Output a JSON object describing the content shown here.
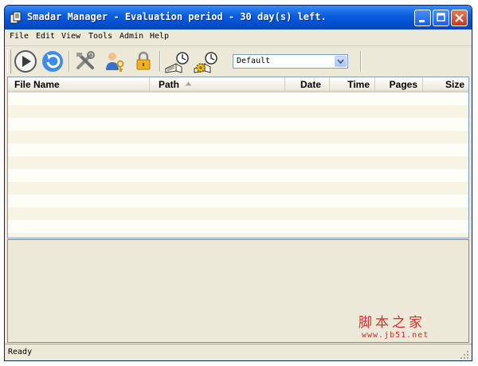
{
  "window": {
    "title": "Smadar Manager - Evaluation period - 30 day(s) left."
  },
  "menu": [
    "File",
    "Edit",
    "View",
    "Tools",
    "Admin",
    "Help"
  ],
  "toolbar": {
    "buttons": [
      "play-icon",
      "refresh-icon",
      "tools-icon",
      "user-key-icon",
      "lock-icon",
      "book-clock-icon",
      "book-clock-gear-icon"
    ],
    "profile_select_value": "Default"
  },
  "file_list": {
    "columns": [
      "File Name",
      "Path",
      "Date",
      "Time",
      "Pages",
      "Size"
    ],
    "sorted_column": "Path",
    "rows": []
  },
  "watermark": {
    "text": "脚本之家",
    "url": "www.jb51.net"
  },
  "status": {
    "text": "Ready"
  },
  "colors": {
    "title_bar": "#0a5fe0",
    "close_button": "#c7391f",
    "window_face": "#ece9d8",
    "watermark": "#c8302c"
  }
}
